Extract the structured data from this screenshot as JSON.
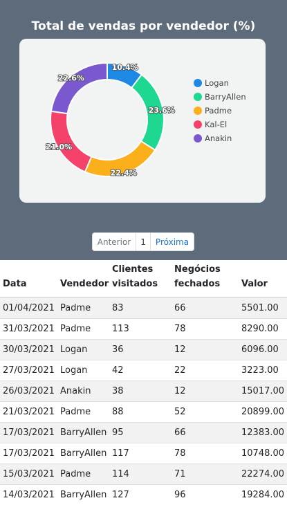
{
  "chart_title": "Total de vendas por vendedor (%)",
  "chart_data": {
    "type": "pie",
    "title": "Total de vendas por vendedor (%)",
    "donut": true,
    "legend_position": "right",
    "categories": [
      "Logan",
      "BarryAllen",
      "Padme",
      "Kal-El",
      "Anakin"
    ],
    "values": [
      10.4,
      23.6,
      22.4,
      21.0,
      22.6
    ],
    "labels": [
      "10.4%",
      "23.6%",
      "22.4%",
      "21.0%",
      "22.6%"
    ],
    "colors": [
      "#1e88e5",
      "#1ed891",
      "#fbaf1a",
      "#f5426a",
      "#7a58d0"
    ]
  },
  "pagination": {
    "prev": "Anterior",
    "page": "1",
    "next": "Próxima"
  },
  "table": {
    "headers": [
      "Data",
      "Vendedor",
      "Clientes visitados",
      "Negócios fechados",
      "Valor"
    ],
    "rows": [
      [
        "01/04/2021",
        "Padme",
        "83",
        "66",
        "5501.00"
      ],
      [
        "31/03/2021",
        "Padme",
        "113",
        "78",
        "8290.00"
      ],
      [
        "30/03/2021",
        "Logan",
        "36",
        "12",
        "6096.00"
      ],
      [
        "27/03/2021",
        "Logan",
        "42",
        "22",
        "3223.00"
      ],
      [
        "26/03/2021",
        "Anakin",
        "38",
        "12",
        "15017.00"
      ],
      [
        "21/03/2021",
        "Padme",
        "88",
        "52",
        "20899.00"
      ],
      [
        "17/03/2021",
        "BarryAllen",
        "95",
        "66",
        "12383.00"
      ],
      [
        "17/03/2021",
        "BarryAllen",
        "117",
        "78",
        "10748.00"
      ],
      [
        "15/03/2021",
        "Padme",
        "114",
        "71",
        "22274.00"
      ],
      [
        "14/03/2021",
        "BarryAllen",
        "127",
        "96",
        "19284.00"
      ]
    ]
  }
}
